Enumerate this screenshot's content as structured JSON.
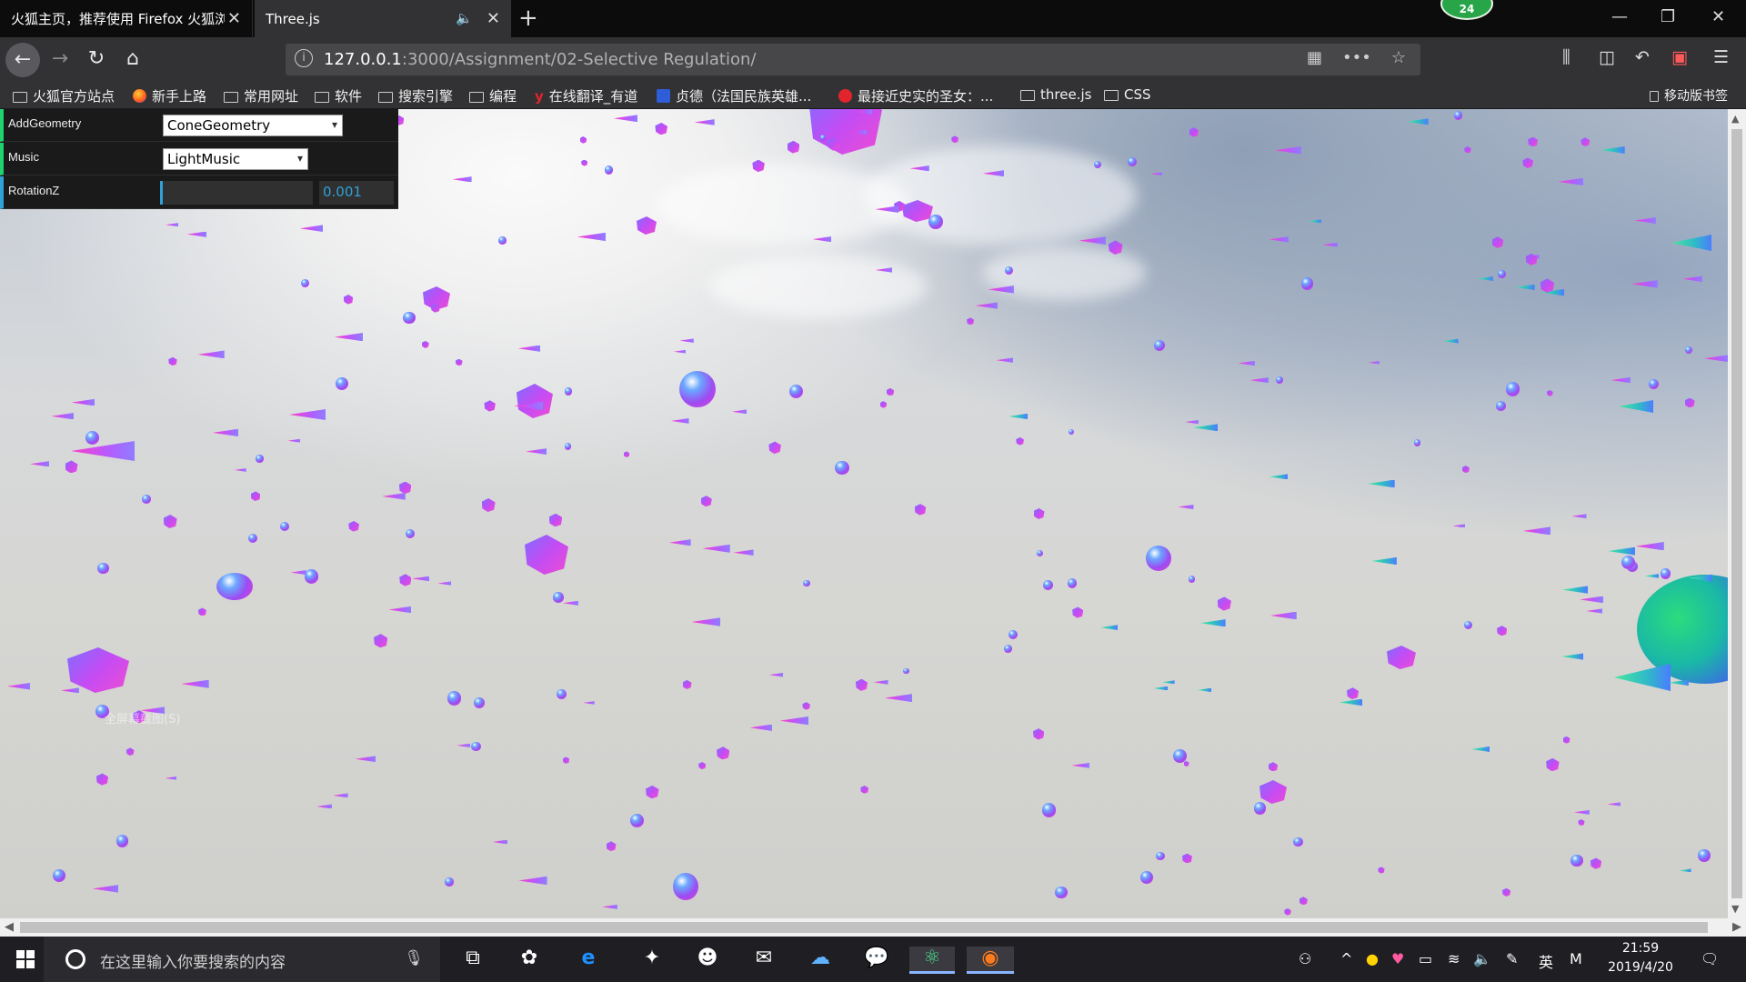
{
  "tabs": [
    {
      "title": "火狐主页，推荐使用 Firefox 火狐浏览器",
      "active": false
    },
    {
      "title": "Three.js",
      "active": true
    }
  ],
  "notification_badge": "24",
  "url": {
    "host": "127.0.0.1",
    "path": ":3000/Assignment/02-Selective Regulation/"
  },
  "bookmarks": [
    {
      "label": "火狐官方站点",
      "icon": "folder-icon"
    },
    {
      "label": "新手上路",
      "icon": "firefox-icon"
    },
    {
      "label": "常用网址",
      "icon": "folder-icon"
    },
    {
      "label": "软件",
      "icon": "folder-icon"
    },
    {
      "label": "搜索引擎",
      "icon": "folder-icon"
    },
    {
      "label": "编程",
      "icon": "folder-icon"
    },
    {
      "label": "在线翻译_有道",
      "icon": "youdao-icon"
    },
    {
      "label": "贞德（法国民族英雄...",
      "icon": "baidu-icon"
    },
    {
      "label": "最接近史实的圣女：...",
      "icon": "weibo-icon"
    },
    {
      "label": "three.js",
      "icon": "folder-icon"
    },
    {
      "label": "CSS",
      "icon": "folder-icon"
    }
  ],
  "mobile_bookmarks": "移动版书签",
  "gui": {
    "add_geometry": {
      "label": "AddGeometry",
      "value": "ConeGeometry"
    },
    "music": {
      "label": "Music",
      "value": "LightMusic"
    },
    "rotation_z": {
      "label": "RotationZ",
      "value": "0.001",
      "fraction": 0.01
    }
  },
  "ghost_text": "全屏幕截图(S)",
  "taskbar": {
    "search_placeholder": "在这里输入你要搜索的内容",
    "ime": "英",
    "ime2": "M",
    "time": "21:59",
    "date": "2019/4/20"
  },
  "colors": {
    "gui_accent": "#1ed36f",
    "number_accent": "#2fa1d6"
  }
}
